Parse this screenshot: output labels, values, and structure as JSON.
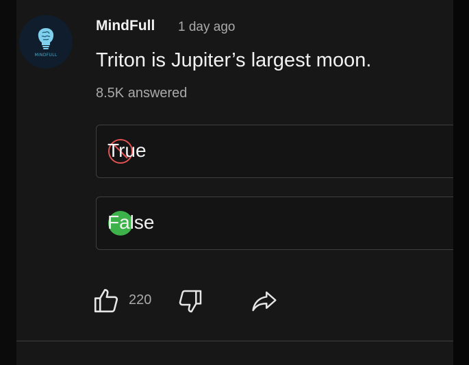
{
  "post": {
    "channel": "MindFull",
    "time": "1 day ago",
    "avatar_text": "MINDFULL",
    "question": "Triton is Jupiter’s largest moon.",
    "answered": "8.5K answered"
  },
  "options": [
    {
      "label": "True",
      "state": "incorrect"
    },
    {
      "label": "False",
      "state": "correct"
    }
  ],
  "actions": {
    "like_count": "220",
    "like_icon": "thumbs-up-icon",
    "dislike_icon": "thumbs-down-icon",
    "share_icon": "share-icon"
  },
  "colors": {
    "background": "#171717",
    "incorrect": "#e25252",
    "correct": "#3eb24a",
    "avatar_bg": "#0f1d2c"
  }
}
